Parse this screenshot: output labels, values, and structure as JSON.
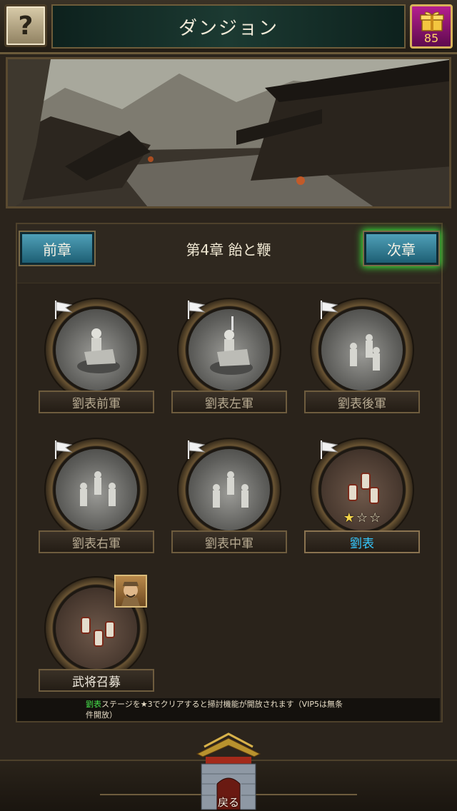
{
  "header": {
    "help_label": "?",
    "title": "ダンジョン",
    "vip_count": "85"
  },
  "chapter": {
    "prev_label": "前章",
    "next_label": "次章",
    "title": "第4章 飴と鞭"
  },
  "stages": [
    {
      "name": "劉表前軍",
      "cleared": true
    },
    {
      "name": "劉表左軍",
      "cleared": true
    },
    {
      "name": "劉表後軍",
      "cleared": true
    },
    {
      "name": "劉表右軍",
      "cleared": true
    },
    {
      "name": "劉表中軍",
      "cleared": true
    },
    {
      "name": "劉表",
      "cleared": true,
      "stars_earned": 1,
      "stars_total": 3
    },
    {
      "name": "武将召募",
      "hero_badge": true
    }
  ],
  "notice": {
    "highlight": "劉表",
    "text_line1": "ステージを★3でクリアすると掃討機能が開放されます（VIP5は無条",
    "text_line2": "件開放）"
  },
  "footer": {
    "back_label": "戻る"
  },
  "colors": {
    "active_stage": "#35c8ff",
    "next_glow": "#3dff3d",
    "notice_highlight": "#45e04a"
  }
}
